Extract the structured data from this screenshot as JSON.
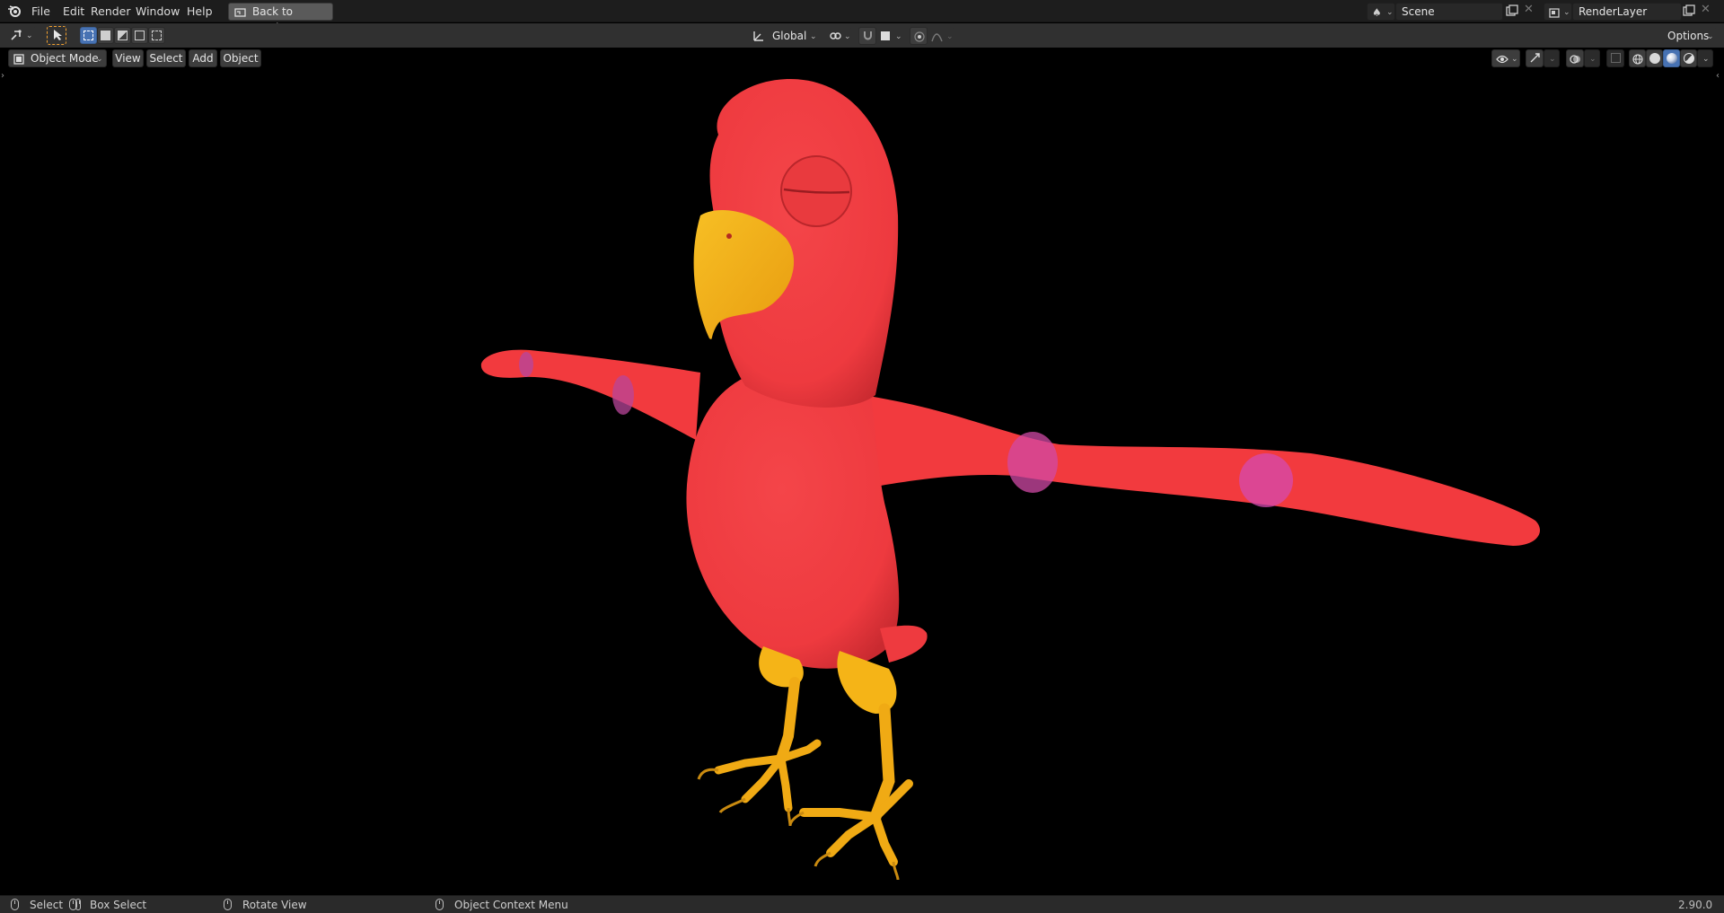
{
  "topbar": {
    "menus": [
      "File",
      "Edit",
      "Render",
      "Window",
      "Help"
    ],
    "back_button": "Back to Previous",
    "scene_name": "Scene",
    "render_layer": "RenderLayer"
  },
  "toolbar": {
    "transform_orientation": "Global",
    "options_label": "Options"
  },
  "header": {
    "mode": "Object Mode",
    "menus": [
      "View",
      "Select",
      "Add",
      "Object"
    ]
  },
  "statusbar": {
    "select": "Select",
    "box_select": "Box Select",
    "rotate_view": "Rotate View",
    "context_menu": "Object Context Menu",
    "version": "2.90.0"
  },
  "colors": {
    "body": "#f23a3e",
    "beak_feet": "#f5b417",
    "stripe": "#d94aa6",
    "active_button": "#4772b3"
  },
  "viewport": {
    "model": "parrot-model"
  }
}
